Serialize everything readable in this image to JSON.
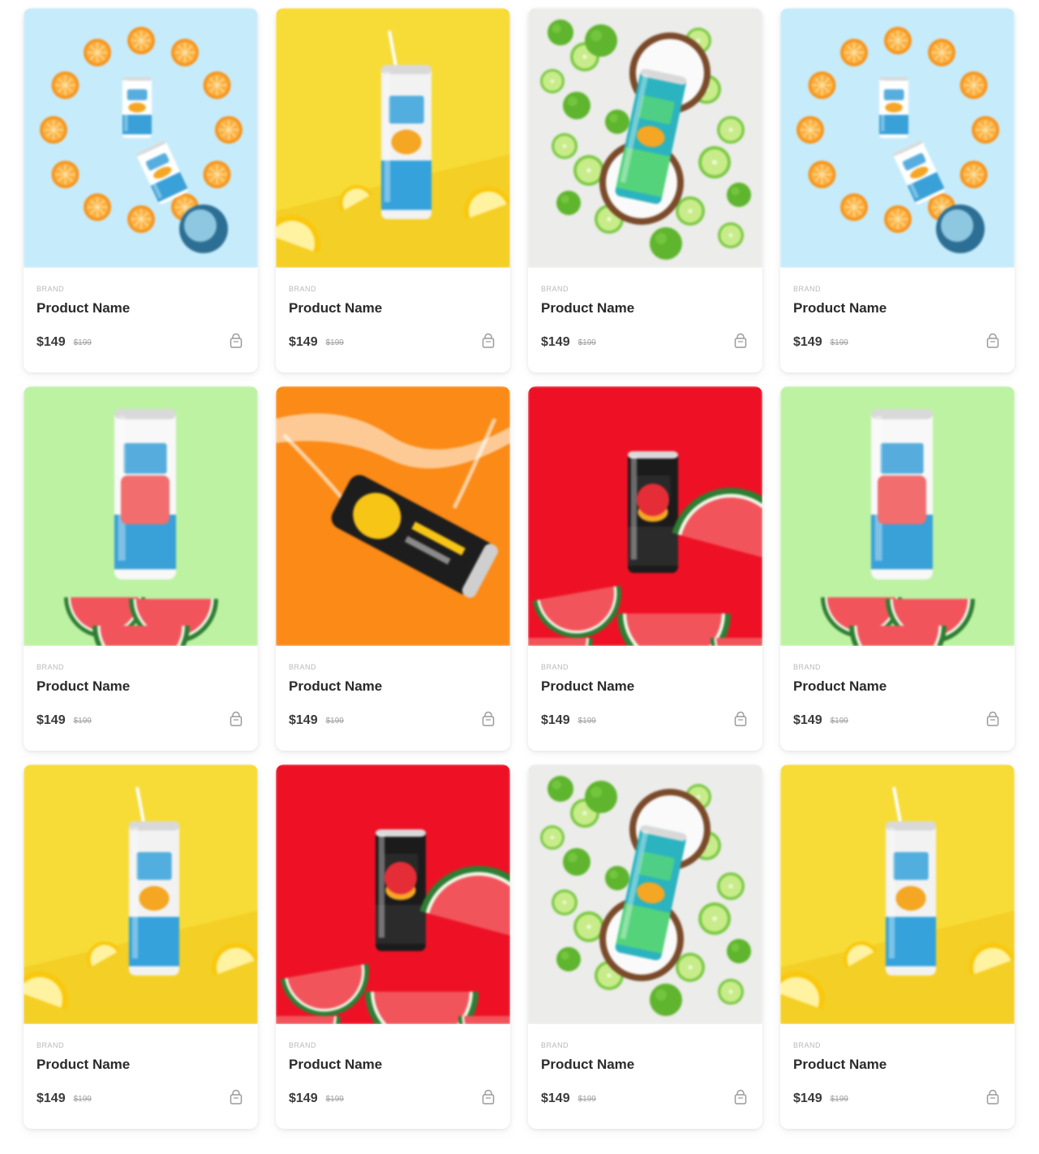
{
  "products": [
    {
      "brand": "BRAND",
      "name": "Product Name",
      "price": "$149",
      "old_price": "$199",
      "photo": "orange-clock"
    },
    {
      "brand": "BRAND",
      "name": "Product Name",
      "price": "$149",
      "old_price": "$199",
      "photo": "lemon-yellow"
    },
    {
      "brand": "BRAND",
      "name": "Product Name",
      "price": "$149",
      "old_price": "$199",
      "photo": "lime-coconut"
    },
    {
      "brand": "BRAND",
      "name": "Product Name",
      "price": "$149",
      "old_price": "$199",
      "photo": "orange-clock"
    },
    {
      "brand": "BRAND",
      "name": "Product Name",
      "price": "$149",
      "old_price": "$199",
      "photo": "watermelon-green"
    },
    {
      "brand": "BRAND",
      "name": "Product Name",
      "price": "$149",
      "old_price": "$199",
      "photo": "splash-orange"
    },
    {
      "brand": "BRAND",
      "name": "Product Name",
      "price": "$149",
      "old_price": "$199",
      "photo": "watermelon-red"
    },
    {
      "brand": "BRAND",
      "name": "Product Name",
      "price": "$149",
      "old_price": "$199",
      "photo": "watermelon-green"
    },
    {
      "brand": "BRAND",
      "name": "Product Name",
      "price": "$149",
      "old_price": "$199",
      "photo": "lemon-yellow"
    },
    {
      "brand": "BRAND",
      "name": "Product Name",
      "price": "$149",
      "old_price": "$199",
      "photo": "watermelon-red"
    },
    {
      "brand": "BRAND",
      "name": "Product Name",
      "price": "$149",
      "old_price": "$199",
      "photo": "lime-coconut"
    },
    {
      "brand": "BRAND",
      "name": "Product Name",
      "price": "$149",
      "old_price": "$199",
      "photo": "lemon-yellow"
    }
  ],
  "icons": {
    "cart": "shopping-bag-icon"
  },
  "colors": {
    "orange_clock_bg": "#c6ecfb",
    "lemon_bg": "#f7dc38",
    "lime_bg": "#ececea",
    "watermelon_green_bg": "#bdf2a3",
    "splash_bg": "#fb8a16",
    "watermelon_red_bg": "#ee1125"
  }
}
